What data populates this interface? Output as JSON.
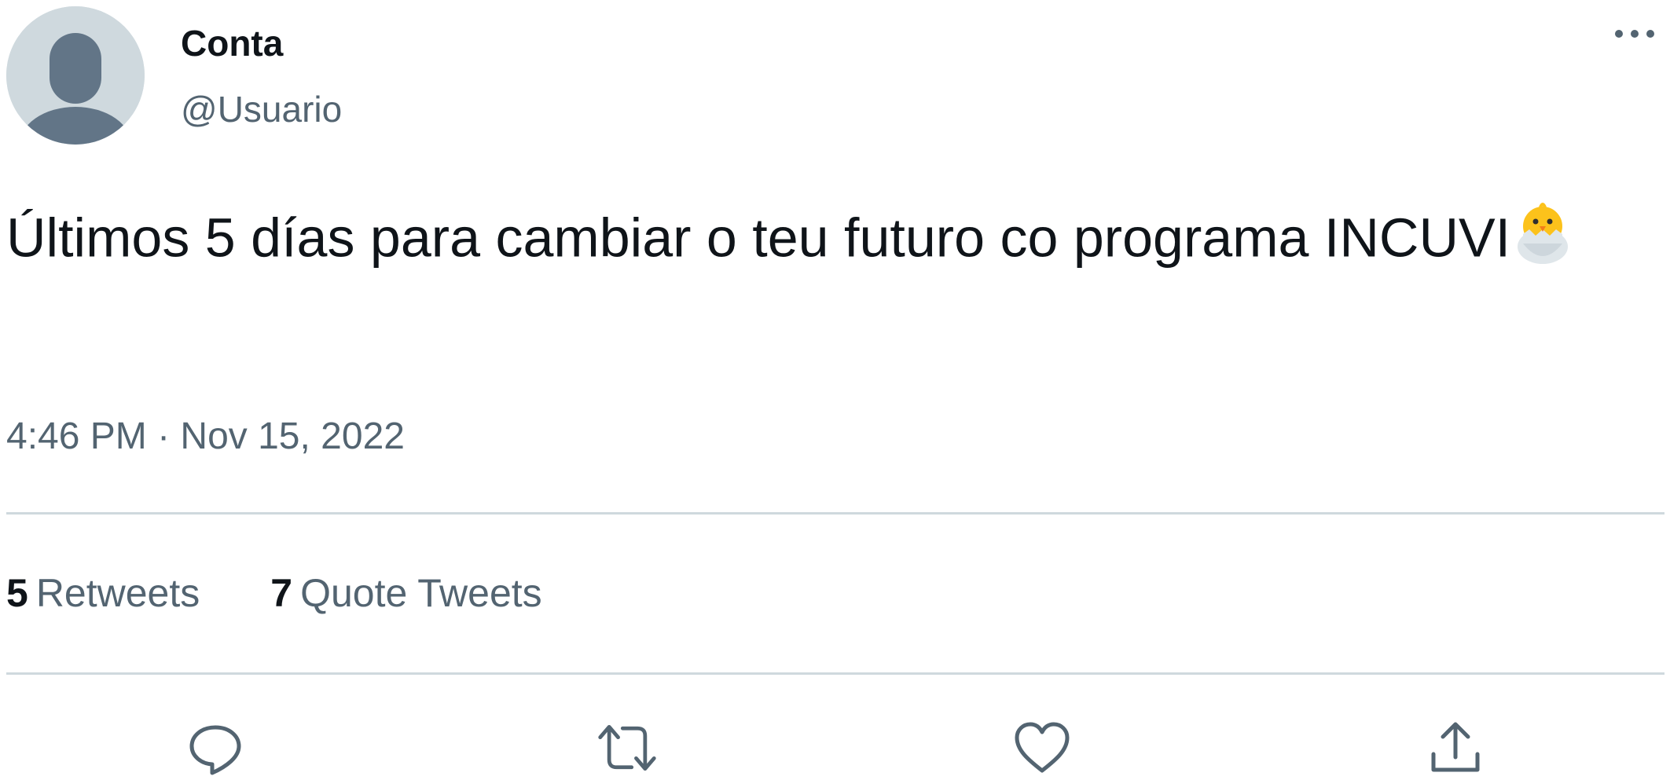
{
  "author": {
    "display_name": "Conta",
    "handle": "@Usuario"
  },
  "tweet": {
    "text": "Últimos 5 días para cambiar o teu futuro co programa INCUVI",
    "emoji": "hatching-chick",
    "timestamp": "4:46 PM · Nov 15, 2022"
  },
  "stats": {
    "retweets_count": "5",
    "retweets_label": "Retweets",
    "quotes_count": "7",
    "quotes_label": "Quote Tweets"
  },
  "actions": [
    "reply-icon",
    "retweet-icon",
    "like-icon",
    "share-icon"
  ],
  "colors": {
    "text_primary": "#0f1419",
    "text_secondary": "#536471",
    "divider": "#cfd9de",
    "avatar_bg": "#cfd9de",
    "avatar_silhouette": "#627587"
  }
}
